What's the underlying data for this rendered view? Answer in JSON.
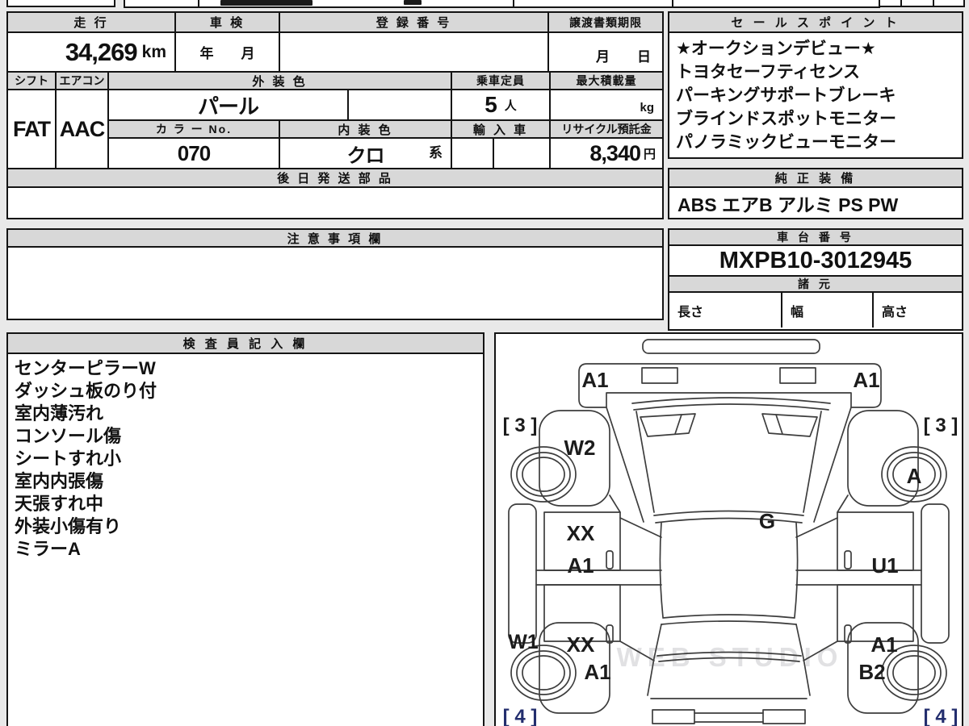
{
  "top": {
    "mileage_label": "走 行",
    "shaken_label": "車 検",
    "registration_label": "登 録 番 号",
    "transfer_label": "譲渡書類期限",
    "mileage_value": "34,269",
    "mileage_unit": "km",
    "shaken_placeholder": "年　　月",
    "transfer_placeholder": "月　　日"
  },
  "row2": {
    "shift_label": "シフト",
    "aircon_label": "エアコン",
    "ext_color_label": "外 装 色",
    "capacity_label": "乗車定員",
    "max_load_label": "最大積載量",
    "shift_value": "FAT",
    "aircon_value": "AAC",
    "ext_color_value": "パール",
    "capacity_value": "5",
    "capacity_unit": "人",
    "max_load_unit": "kg",
    "color_no_label": "カ ラ ー No.",
    "int_color_label": "内 装 色",
    "import_label": "輸 入 車",
    "recycle_label": "リサイクル預託金",
    "color_no_value": "070",
    "int_color_value": "クロ",
    "int_color_suffix": "系",
    "recycle_value": "8,340",
    "recycle_unit": "円"
  },
  "later_parts": {
    "label": "後 日 発 送 部 品",
    "value": ""
  },
  "sales": {
    "label": "セ ー ル ス ポ イ ン ト",
    "lines": [
      "★オークションデビュー★",
      "トヨタセーフティセンス",
      "パーキングサポートブレーキ",
      "ブラインドスポットモニター",
      "パノラミックビューモニター"
    ]
  },
  "equipment": {
    "label": "純 正 装 備",
    "value": "ABS エアB アルミ PS PW"
  },
  "caution": {
    "label": "注 意 事 項 欄",
    "value": ""
  },
  "chassis": {
    "label": "車 台 番 号",
    "value": "MXPB10-3012945"
  },
  "specs": {
    "label": "諸 元",
    "length_label": "長さ",
    "width_label": "幅",
    "height_label": "高さ"
  },
  "inspector": {
    "label": "検 査 員 記 入 欄",
    "lines": [
      "センターピラーW",
      "ダッシュ板のり付",
      "室内薄汚れ",
      "コンソール傷",
      "シートすれ小",
      "室内内張傷",
      "天張すれ中",
      "外装小傷有り",
      "ミラーA"
    ]
  },
  "diagram": {
    "watermark": "WEB STUDIO",
    "labels": {
      "front_left": "A1",
      "front_right": "A1",
      "corner_fl": "[ 3 ]",
      "corner_fr": "[ 3 ]",
      "fender_fl": "W2",
      "wheel_fr": "A",
      "cowl": "G",
      "door_fl_top": "XX",
      "door_fl_bottom": "A1",
      "door_fr": "U1",
      "rocker_left": "W1",
      "door_rl": "XX",
      "door_rr": "A1",
      "wheel_rl": "A1",
      "wheel_rr": "B2",
      "corner_rl": "[ 4 ]",
      "corner_rr": "[ 4 ]"
    }
  }
}
